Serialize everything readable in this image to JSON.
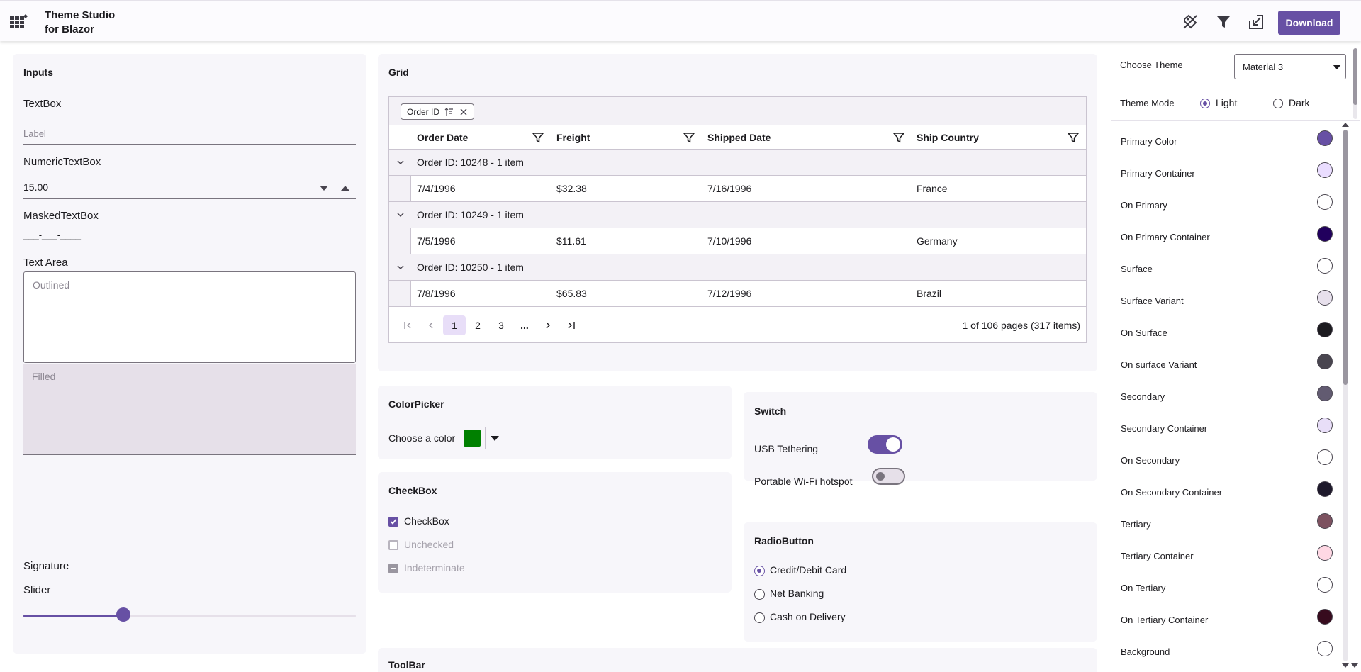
{
  "header": {
    "title_line1": "Theme Studio",
    "title_line2": "for Blazor",
    "download_label": "Download"
  },
  "inputs": {
    "title": "Inputs",
    "textbox_label": "TextBox",
    "textbox_placeholder": "Label",
    "numeric_label": "NumericTextBox",
    "numeric_value": "15.00",
    "masked_label": "MaskedTextBox",
    "masked_value": "___-___-____",
    "textarea_label": "Text Area",
    "textarea_outlined_placeholder": "Outlined",
    "textarea_filled_placeholder": "Filled",
    "signature_label": "Signature",
    "slider_label": "Slider",
    "slider_value_fraction": 0.3
  },
  "grid": {
    "title": "Grid",
    "group_chip": "Order ID",
    "columns": [
      "Order Date",
      "Freight",
      "Shipped Date",
      "Ship Country"
    ],
    "groups": [
      {
        "caption": "Order ID: 10248 - 1 item",
        "row": [
          "7/4/1996",
          "$32.38",
          "7/16/1996",
          "France"
        ]
      },
      {
        "caption": "Order ID: 10249 - 1 item",
        "row": [
          "7/5/1996",
          "$11.61",
          "7/10/1996",
          "Germany"
        ]
      },
      {
        "caption": "Order ID: 10250 - 1 item",
        "row": [
          "7/8/1996",
          "$65.83",
          "7/12/1996",
          "Brazil"
        ]
      }
    ],
    "pages": [
      "1",
      "2",
      "3",
      "..."
    ],
    "pager_info": "1 of 106 pages (317 items)"
  },
  "colorpicker": {
    "title": "ColorPicker",
    "label": "Choose a color",
    "value": "#008000"
  },
  "checkbox": {
    "title": "CheckBox",
    "items": [
      {
        "label": "CheckBox",
        "state": "checked"
      },
      {
        "label": "Unchecked",
        "state": "unchecked"
      },
      {
        "label": "Indeterminate",
        "state": "indeterminate"
      }
    ]
  },
  "switch": {
    "title": "Switch",
    "items": [
      {
        "label": "USB Tethering",
        "on": true
      },
      {
        "label": "Portable Wi-Fi hotspot",
        "on": false
      }
    ]
  },
  "radio": {
    "title": "RadioButton",
    "items": [
      {
        "label": "Credit/Debit Card",
        "selected": true
      },
      {
        "label": "Net Banking",
        "selected": false
      },
      {
        "label": "Cash on Delivery",
        "selected": false
      }
    ]
  },
  "toolbar": {
    "title": "ToolBar"
  },
  "sidebar": {
    "choose_theme_label": "Choose Theme",
    "theme_value": "Material 3",
    "theme_mode_label": "Theme Mode",
    "mode_light": "Light",
    "mode_dark": "Dark",
    "mode_selected": "Light",
    "colors": [
      {
        "name": "Primary Color",
        "hex": "#6750a4"
      },
      {
        "name": "Primary Container",
        "hex": "#eaddff"
      },
      {
        "name": "On Primary",
        "hex": "#ffffff"
      },
      {
        "name": "On Primary Container",
        "hex": "#21005d"
      },
      {
        "name": "Surface",
        "hex": "#ffffff"
      },
      {
        "name": "Surface Variant",
        "hex": "#e7e0ec"
      },
      {
        "name": "On Surface",
        "hex": "#1c1b1f"
      },
      {
        "name": "On surface Variant",
        "hex": "#49454f"
      },
      {
        "name": "Secondary",
        "hex": "#625b71"
      },
      {
        "name": "Secondary Container",
        "hex": "#e8def8"
      },
      {
        "name": "On Secondary",
        "hex": "#ffffff"
      },
      {
        "name": "On Secondary Container",
        "hex": "#1e192b"
      },
      {
        "name": "Tertiary",
        "hex": "#7d5260"
      },
      {
        "name": "Tertiary Container",
        "hex": "#ffd8e4"
      },
      {
        "name": "On Tertiary",
        "hex": "#ffffff"
      },
      {
        "name": "On Tertiary Container",
        "hex": "#370b1e"
      },
      {
        "name": "Background",
        "hex": "#ffffff"
      }
    ]
  },
  "colors": {
    "accent": "#6750a4",
    "surface": "#f7f6fa"
  }
}
